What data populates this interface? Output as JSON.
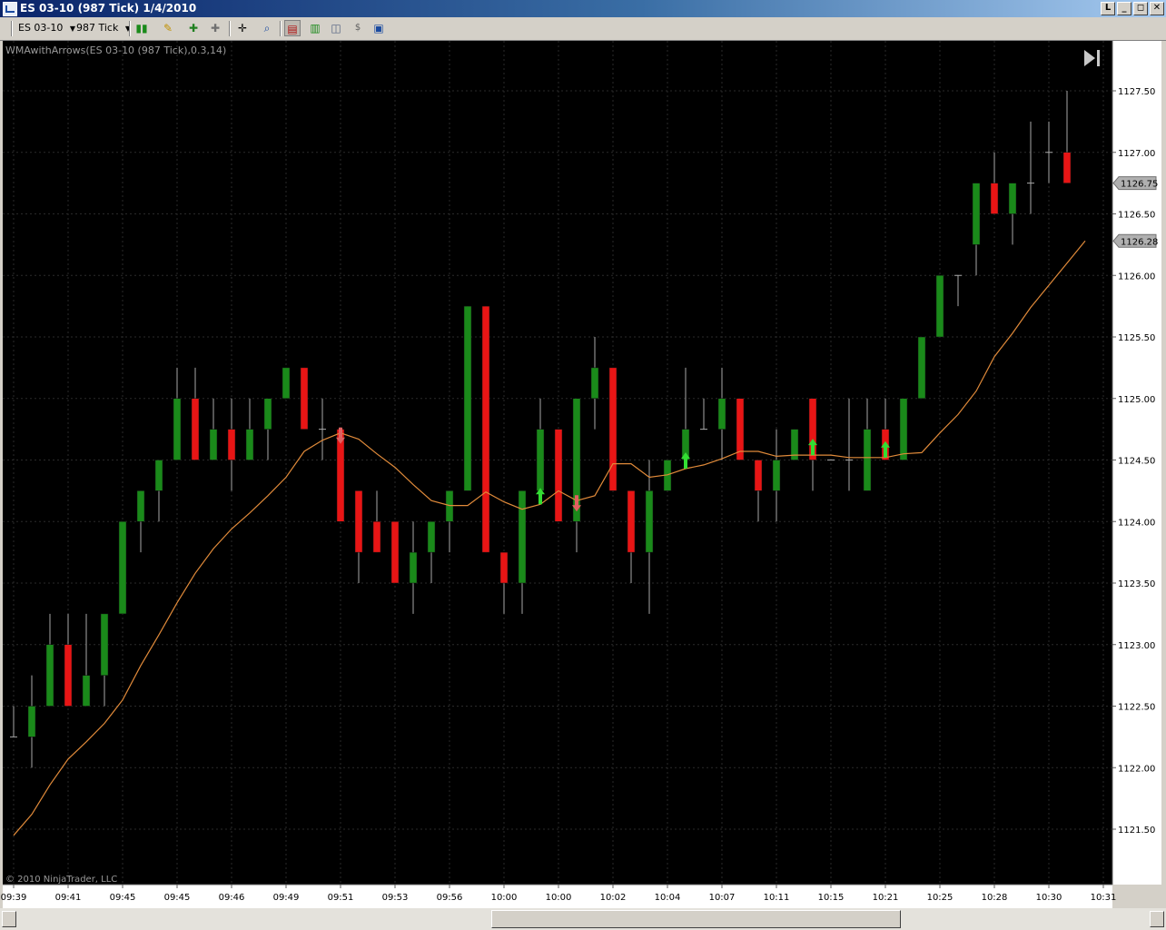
{
  "window": {
    "title": "ES 03-10 (987 Tick)  1/4/2010",
    "buttons": [
      "L",
      "_",
      "◻",
      "✕"
    ]
  },
  "toolbar": {
    "instrument": "ES 03-10",
    "interval": "987 Tick",
    "icons": [
      "chart-style-icon",
      "drawing-pencil-icon",
      "indicator-icon",
      "strategy-icon",
      "crosshair-icon",
      "zoom-icon",
      "properties-icon",
      "bars-icon",
      "data-box-icon",
      "dollar-icon",
      "panel-icon"
    ]
  },
  "chart": {
    "indicator_label": "WMAwithArrows(ES 03-10 (987 Tick),0.3,14)",
    "copyright": "© 2010 NinjaTrader, LLC",
    "last_price_label": "1126.75",
    "wma_label": "1126.28",
    "colors": {
      "up": "#1a8a1a",
      "down": "#e81515",
      "wma": "#e08a3a",
      "arrow_up": "#33dd33",
      "arrow_down": "#e06060",
      "background": "#000000"
    }
  },
  "chart_data": {
    "type": "candlestick",
    "y_ticks": [
      "1127.50",
      "1127.00",
      "1126.50",
      "1126.00",
      "1125.50",
      "1125.00",
      "1124.50",
      "1124.00",
      "1123.50",
      "1123.00",
      "1122.50",
      "1122.00",
      "1121.50"
    ],
    "ylim": [
      1121.25,
      1127.85
    ],
    "x_ticks": [
      {
        "i": 0,
        "label": "09:39"
      },
      {
        "i": 3,
        "label": "09:41"
      },
      {
        "i": 6,
        "label": "09:45"
      },
      {
        "i": 9,
        "label": "09:45"
      },
      {
        "i": 12,
        "label": "09:46"
      },
      {
        "i": 15,
        "label": "09:49"
      },
      {
        "i": 18,
        "label": "09:51"
      },
      {
        "i": 21,
        "label": "09:53"
      },
      {
        "i": 24,
        "label": "09:56"
      },
      {
        "i": 27,
        "label": "10:00"
      },
      {
        "i": 30,
        "label": "10:00"
      },
      {
        "i": 33,
        "label": "10:02"
      },
      {
        "i": 36,
        "label": "10:04"
      },
      {
        "i": 39,
        "label": "10:07"
      },
      {
        "i": 42,
        "label": "10:11"
      },
      {
        "i": 45,
        "label": "10:15"
      },
      {
        "i": 48,
        "label": "10:21"
      },
      {
        "i": 51,
        "label": "10:25"
      },
      {
        "i": 54,
        "label": "10:28"
      },
      {
        "i": 57,
        "label": "10:30"
      },
      {
        "i": 60,
        "label": "10:31"
      }
    ],
    "candles": [
      {
        "o": 1122.25,
        "h": 1122.5,
        "l": 1122.25,
        "c": 1122.25
      },
      {
        "o": 1122.25,
        "h": 1122.75,
        "l": 1122.0,
        "c": 1122.5
      },
      {
        "o": 1122.5,
        "h": 1123.25,
        "l": 1122.5,
        "c": 1123.0
      },
      {
        "o": 1123.0,
        "h": 1123.25,
        "l": 1122.5,
        "c": 1122.5
      },
      {
        "o": 1122.5,
        "h": 1123.25,
        "l": 1122.5,
        "c": 1122.75
      },
      {
        "o": 1122.75,
        "h": 1123.25,
        "l": 1122.5,
        "c": 1123.25
      },
      {
        "o": 1123.25,
        "h": 1124.0,
        "l": 1123.25,
        "c": 1124.0
      },
      {
        "o": 1124.0,
        "h": 1124.25,
        "l": 1123.75,
        "c": 1124.25
      },
      {
        "o": 1124.25,
        "h": 1124.5,
        "l": 1124.0,
        "c": 1124.5
      },
      {
        "o": 1124.5,
        "h": 1125.25,
        "l": 1124.5,
        "c": 1125.0
      },
      {
        "o": 1125.0,
        "h": 1125.25,
        "l": 1124.5,
        "c": 1124.5
      },
      {
        "o": 1124.5,
        "h": 1125.0,
        "l": 1124.5,
        "c": 1124.75
      },
      {
        "o": 1124.75,
        "h": 1125.0,
        "l": 1124.25,
        "c": 1124.5
      },
      {
        "o": 1124.5,
        "h": 1125.0,
        "l": 1124.5,
        "c": 1124.75
      },
      {
        "o": 1124.75,
        "h": 1125.0,
        "l": 1124.5,
        "c": 1125.0
      },
      {
        "o": 1125.0,
        "h": 1125.25,
        "l": 1125.0,
        "c": 1125.25
      },
      {
        "o": 1125.25,
        "h": 1125.25,
        "l": 1124.75,
        "c": 1124.75
      },
      {
        "o": 1124.75,
        "h": 1125.0,
        "l": 1124.5,
        "c": 1124.75
      },
      {
        "o": 1124.75,
        "h": 1124.75,
        "l": 1124.0,
        "c": 1124.0
      },
      {
        "o": 1124.25,
        "h": 1124.25,
        "l": 1123.5,
        "c": 1123.75
      },
      {
        "o": 1124.0,
        "h": 1124.25,
        "l": 1123.75,
        "c": 1123.75
      },
      {
        "o": 1124.0,
        "h": 1124.0,
        "l": 1123.5,
        "c": 1123.5
      },
      {
        "o": 1123.5,
        "h": 1124.0,
        "l": 1123.25,
        "c": 1123.75
      },
      {
        "o": 1123.75,
        "h": 1124.0,
        "l": 1123.5,
        "c": 1124.0
      },
      {
        "o": 1124.0,
        "h": 1124.25,
        "l": 1123.75,
        "c": 1124.25
      },
      {
        "o": 1124.25,
        "h": 1125.75,
        "l": 1124.25,
        "c": 1125.75
      },
      {
        "o": 1125.75,
        "h": 1125.75,
        "l": 1123.75,
        "c": 1123.75
      },
      {
        "o": 1123.75,
        "h": 1123.75,
        "l": 1123.25,
        "c": 1123.5
      },
      {
        "o": 1123.5,
        "h": 1124.25,
        "l": 1123.25,
        "c": 1124.25
      },
      {
        "o": 1124.25,
        "h": 1125.0,
        "l": 1124.25,
        "c": 1124.75
      },
      {
        "o": 1124.75,
        "h": 1124.75,
        "l": 1124.0,
        "c": 1124.0
      },
      {
        "o": 1124.0,
        "h": 1125.0,
        "l": 1123.75,
        "c": 1125.0
      },
      {
        "o": 1125.0,
        "h": 1125.5,
        "l": 1124.75,
        "c": 1125.25
      },
      {
        "o": 1125.25,
        "h": 1125.25,
        "l": 1124.25,
        "c": 1124.25
      },
      {
        "o": 1124.25,
        "h": 1124.25,
        "l": 1123.5,
        "c": 1123.75
      },
      {
        "o": 1123.75,
        "h": 1124.5,
        "l": 1123.25,
        "c": 1124.25
      },
      {
        "o": 1124.25,
        "h": 1124.5,
        "l": 1124.25,
        "c": 1124.5
      },
      {
        "o": 1124.5,
        "h": 1125.25,
        "l": 1124.5,
        "c": 1124.75
      },
      {
        "o": 1124.75,
        "h": 1125.0,
        "l": 1124.75,
        "c": 1124.75
      },
      {
        "o": 1124.75,
        "h": 1125.25,
        "l": 1124.5,
        "c": 1125.0
      },
      {
        "o": 1125.0,
        "h": 1125.0,
        "l": 1124.5,
        "c": 1124.5
      },
      {
        "o": 1124.5,
        "h": 1124.5,
        "l": 1124.0,
        "c": 1124.25
      },
      {
        "o": 1124.25,
        "h": 1124.75,
        "l": 1124.0,
        "c": 1124.5
      },
      {
        "o": 1124.5,
        "h": 1124.75,
        "l": 1124.5,
        "c": 1124.75
      },
      {
        "o": 1125.0,
        "h": 1125.0,
        "l": 1124.25,
        "c": 1124.5
      },
      {
        "o": 1124.5,
        "h": 1124.5,
        "l": 1124.5,
        "c": 1124.5
      },
      {
        "o": 1124.5,
        "h": 1125.0,
        "l": 1124.25,
        "c": 1124.5
      },
      {
        "o": 1124.25,
        "h": 1125.0,
        "l": 1124.25,
        "c": 1124.75
      },
      {
        "o": 1124.75,
        "h": 1125.0,
        "l": 1124.5,
        "c": 1124.5
      },
      {
        "o": 1124.5,
        "h": 1125.0,
        "l": 1124.5,
        "c": 1125.0
      },
      {
        "o": 1125.0,
        "h": 1125.5,
        "l": 1125.0,
        "c": 1125.5
      },
      {
        "o": 1125.5,
        "h": 1126.0,
        "l": 1125.5,
        "c": 1126.0
      },
      {
        "o": 1126.0,
        "h": 1126.0,
        "l": 1125.75,
        "c": 1126.0
      },
      {
        "o": 1126.25,
        "h": 1126.75,
        "l": 1126.0,
        "c": 1126.75
      },
      {
        "o": 1126.75,
        "h": 1127.0,
        "l": 1126.5,
        "c": 1126.5
      },
      {
        "o": 1126.5,
        "h": 1126.75,
        "l": 1126.25,
        "c": 1126.75
      },
      {
        "o": 1126.75,
        "h": 1127.25,
        "l": 1126.5,
        "c": 1126.75
      },
      {
        "o": 1127.0,
        "h": 1127.25,
        "l": 1126.75,
        "c": 1127.0
      },
      {
        "o": 1127.0,
        "h": 1127.5,
        "l": 1126.75,
        "c": 1126.75
      }
    ],
    "wma": [
      1121.45,
      1121.62,
      1121.86,
      1122.07,
      1122.21,
      1122.36,
      1122.55,
      1122.83,
      1123.08,
      1123.34,
      1123.58,
      1123.78,
      1123.94,
      1124.07,
      1124.21,
      1124.36,
      1124.57,
      1124.66,
      1124.72,
      1124.67,
      1124.55,
      1124.44,
      1124.3,
      1124.17,
      1124.13,
      1124.13,
      1124.24,
      1124.16,
      1124.1,
      1124.14,
      1124.25,
      1124.17,
      1124.21,
      1124.47,
      1124.47,
      1124.36,
      1124.38,
      1124.43,
      1124.46,
      1124.51,
      1124.57,
      1124.57,
      1124.53,
      1124.54,
      1124.54,
      1124.54,
      1124.52,
      1124.52,
      1124.52,
      1124.55,
      1124.56,
      1124.72,
      1124.87,
      1125.06,
      1125.34,
      1125.53,
      1125.74,
      1125.92,
      1126.1,
      1126.28
    ],
    "arrows": [
      {
        "i": 18,
        "dir": "down"
      },
      {
        "i": 29,
        "dir": "up"
      },
      {
        "i": 31,
        "dir": "down"
      },
      {
        "i": 37,
        "dir": "up"
      },
      {
        "i": 44,
        "dir": "up"
      },
      {
        "i": 48,
        "dir": "up"
      }
    ]
  }
}
